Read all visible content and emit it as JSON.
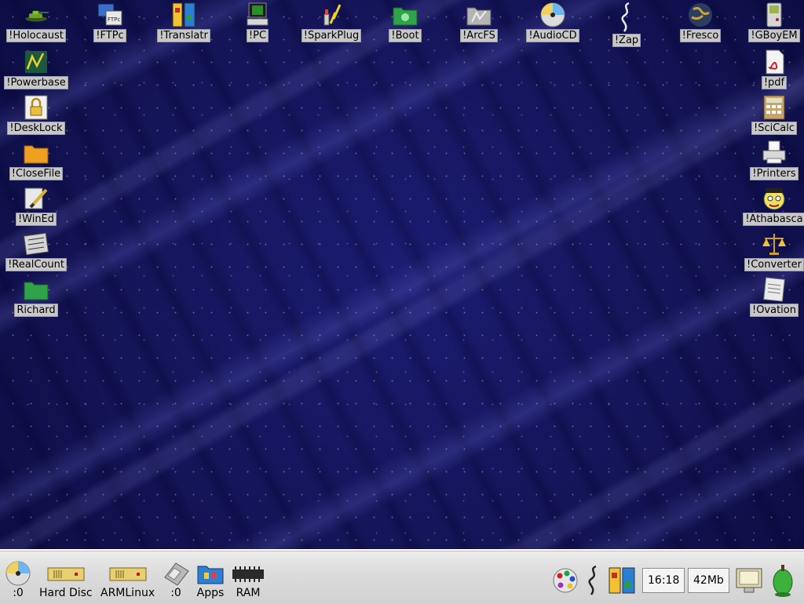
{
  "desktop": {
    "icons_left": [
      {
        "label": "!Holocaust",
        "icon": "tank-icon"
      },
      {
        "label": "!Powerbase",
        "icon": "chart-icon"
      },
      {
        "label": "!DeskLock",
        "icon": "lock-icon"
      },
      {
        "label": "!CloseFile",
        "icon": "folder-icon"
      },
      {
        "label": "!WinEd",
        "icon": "pencil-icon"
      },
      {
        "label": "!RealCount",
        "icon": "counter-icon"
      },
      {
        "label": "Richard",
        "icon": "green-folder-icon"
      }
    ],
    "icons_top": [
      {
        "label": "!FTPc",
        "icon": "ftp-icon"
      },
      {
        "label": "!Translatr",
        "icon": "translator-icon"
      },
      {
        "label": "!PC",
        "icon": "pc-icon"
      },
      {
        "label": "!SparkPlug",
        "icon": "sparkplug-icon"
      },
      {
        "label": "!Boot",
        "icon": "boot-folder-icon"
      },
      {
        "label": "!ArcFS",
        "icon": "archive-folder-icon"
      },
      {
        "label": "!AudioCD",
        "icon": "cd-icon"
      },
      {
        "label": "!Zap",
        "icon": "zap-icon"
      },
      {
        "label": "!Fresco",
        "icon": "globe-icon"
      },
      {
        "label": "!GBoyEM",
        "icon": "gameboy-icon"
      }
    ],
    "icons_right": [
      {
        "label": "!pdf",
        "icon": "pdf-icon"
      },
      {
        "label": "!SciCalc",
        "icon": "calculator-icon"
      },
      {
        "label": "!Printers",
        "icon": "printer-icon"
      },
      {
        "label": "!Athabasca",
        "icon": "face-icon"
      },
      {
        "label": "!Converter",
        "icon": "scales-icon"
      },
      {
        "label": "!Ovation",
        "icon": "document-icon"
      }
    ]
  },
  "iconbar": {
    "cd_label": ":0",
    "hard_disc_label": "Hard Disc",
    "armlinux_label": "ARMLinux",
    "floppy_label": ":0",
    "apps_label": "Apps",
    "ram_label": "RAM",
    "clock": "16:18",
    "memory": "42Mb"
  },
  "colors": {
    "desktop_bg": "#141458",
    "label_bg": "#c8c8c8",
    "iconbar_bg": "#dcdcdc"
  }
}
